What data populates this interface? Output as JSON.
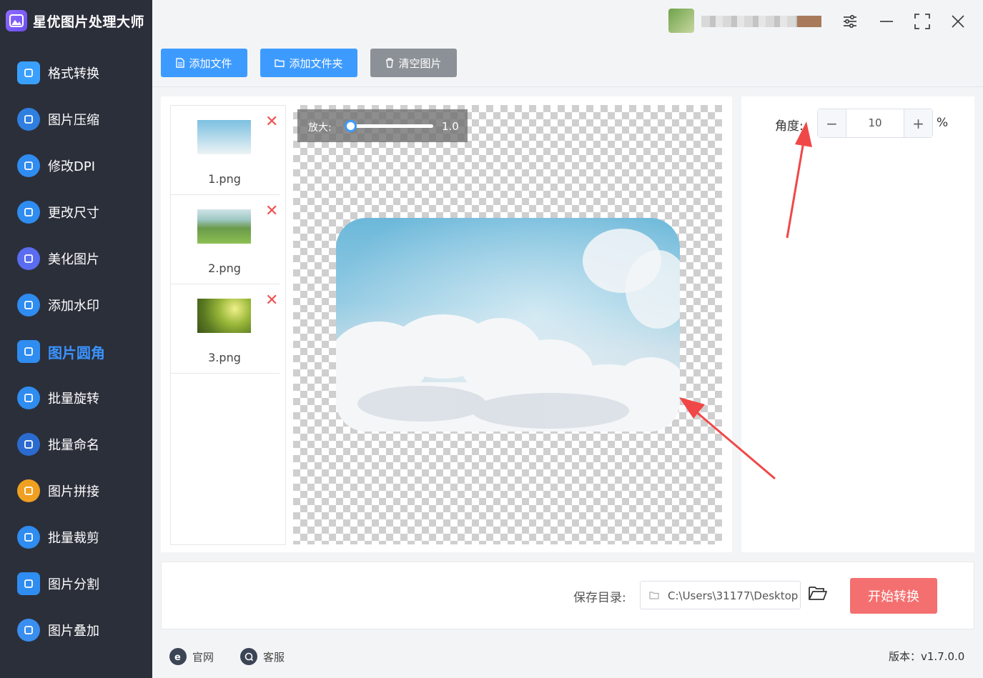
{
  "app": {
    "title": "星优图片处理大师",
    "logo_icon": "image-mountain-icon",
    "accent_color": "#3d9bff"
  },
  "sidebar": {
    "items": [
      {
        "label": "格式转换",
        "icon": "format-convert-icon",
        "active": false
      },
      {
        "label": "图片压缩",
        "icon": "compress-icon",
        "active": false
      },
      {
        "label": "修改DPI",
        "icon": "dpi-icon",
        "active": false
      },
      {
        "label": "更改尺寸",
        "icon": "resize-icon",
        "active": false
      },
      {
        "label": "美化图片",
        "icon": "beautify-icon",
        "active": false
      },
      {
        "label": "添加水印",
        "icon": "watermark-icon",
        "active": false
      },
      {
        "label": "图片圆角",
        "icon": "rounded-corner-icon",
        "active": true
      },
      {
        "label": "批量旋转",
        "icon": "rotate-icon",
        "active": false
      },
      {
        "label": "批量命名",
        "icon": "rename-icon",
        "active": false
      },
      {
        "label": "图片拼接",
        "icon": "stitch-icon",
        "active": false
      },
      {
        "label": "批量裁剪",
        "icon": "crop-icon",
        "active": false
      },
      {
        "label": "图片分割",
        "icon": "split-icon",
        "active": false
      },
      {
        "label": "图片叠加",
        "icon": "overlay-icon",
        "active": false
      }
    ]
  },
  "toolbar": {
    "add_file": "添加文件",
    "add_folder": "添加文件夹",
    "clear_images": "清空图片"
  },
  "file_list": [
    {
      "name": "1.png",
      "thumb": "sky-clouds"
    },
    {
      "name": "2.png",
      "thumb": "green-field"
    },
    {
      "name": "3.png",
      "thumb": "yellow-flowers"
    }
  ],
  "preview": {
    "zoom_label": "放大:",
    "zoom_value": "1.0",
    "zoom_fraction": 0.0
  },
  "settings": {
    "angle_label": "角度:",
    "angle_value": "10",
    "minus": "−",
    "plus": "+",
    "unit": "%"
  },
  "save": {
    "label": "保存目录:",
    "path": "C:\\Users\\31177\\Desktop",
    "start_button": "开始转换"
  },
  "footer": {
    "website": "官网",
    "support": "客服",
    "version": "版本：v1.7.0.0"
  }
}
